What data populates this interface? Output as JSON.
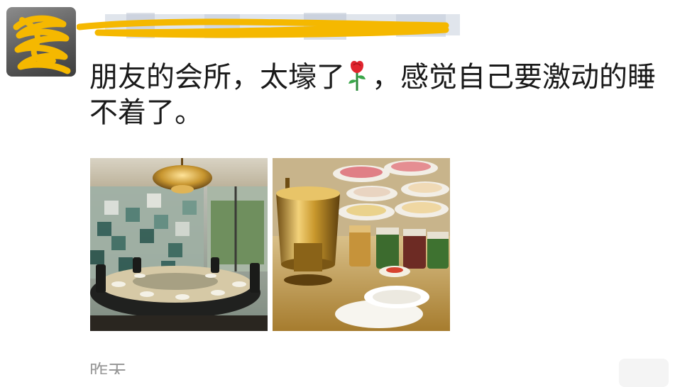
{
  "post": {
    "text": "朋友的会所，太壕了🌹，感觉自己要激动的睡不着了。",
    "text_before_emoji": "朋友的会所，太壕了",
    "emoji": "rose-icon",
    "text_after_emoji": "，感觉自己要激动的睡不着了。",
    "timestamp": "昨天",
    "images": [
      {
        "name": "photo-dining-room"
      },
      {
        "name": "photo-hotpot-table"
      }
    ]
  },
  "colors": {
    "text": "#1a1a1a",
    "timestamp": "#999999",
    "redaction": "#f5b800"
  }
}
